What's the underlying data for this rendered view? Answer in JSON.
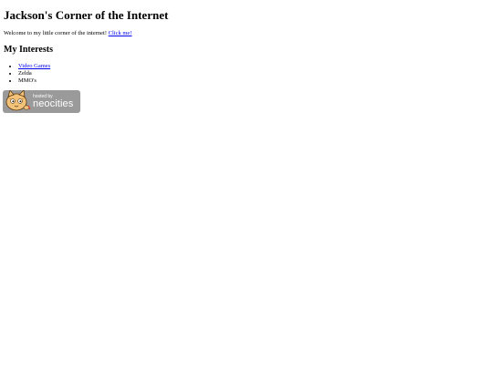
{
  "page": {
    "title": "Jackson's Corner of the Internet",
    "intro_text": "Welcome to my little corner of the internet! ",
    "intro_link": "Click me!",
    "interests_heading": "My Interests",
    "interests": [
      {
        "label": "Video Games",
        "is_link": true
      },
      {
        "label": "Zelda",
        "is_link": false
      },
      {
        "label": "MMO's",
        "is_link": false
      }
    ]
  },
  "badge": {
    "small_text": "hosted by",
    "big_text": "neocities",
    "background_color": "#9a9a9a",
    "icon": "neocities-cat-icon"
  },
  "colors": {
    "link": "#0000ee",
    "text": "#000000",
    "background": "#ffffff"
  }
}
